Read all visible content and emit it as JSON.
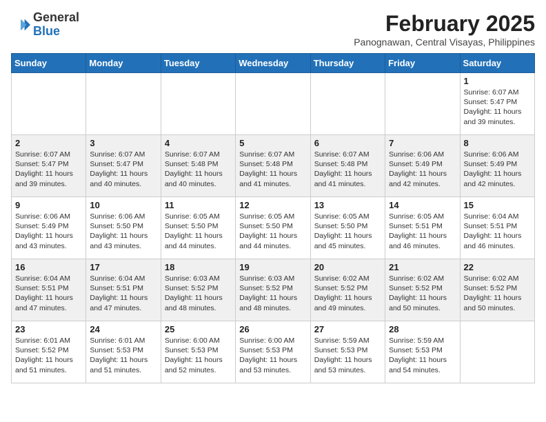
{
  "header": {
    "logo_general": "General",
    "logo_blue": "Blue",
    "month_year": "February 2025",
    "location": "Panognawan, Central Visayas, Philippines"
  },
  "days_of_week": [
    "Sunday",
    "Monday",
    "Tuesday",
    "Wednesday",
    "Thursday",
    "Friday",
    "Saturday"
  ],
  "weeks": [
    [
      {
        "day": "",
        "sunrise": "",
        "sunset": "",
        "daylight": ""
      },
      {
        "day": "",
        "sunrise": "",
        "sunset": "",
        "daylight": ""
      },
      {
        "day": "",
        "sunrise": "",
        "sunset": "",
        "daylight": ""
      },
      {
        "day": "",
        "sunrise": "",
        "sunset": "",
        "daylight": ""
      },
      {
        "day": "",
        "sunrise": "",
        "sunset": "",
        "daylight": ""
      },
      {
        "day": "",
        "sunrise": "",
        "sunset": "",
        "daylight": ""
      },
      {
        "day": "1",
        "sunrise": "Sunrise: 6:07 AM",
        "sunset": "Sunset: 5:47 PM",
        "daylight": "Daylight: 11 hours and 39 minutes."
      }
    ],
    [
      {
        "day": "2",
        "sunrise": "Sunrise: 6:07 AM",
        "sunset": "Sunset: 5:47 PM",
        "daylight": "Daylight: 11 hours and 39 minutes."
      },
      {
        "day": "3",
        "sunrise": "Sunrise: 6:07 AM",
        "sunset": "Sunset: 5:47 PM",
        "daylight": "Daylight: 11 hours and 40 minutes."
      },
      {
        "day": "4",
        "sunrise": "Sunrise: 6:07 AM",
        "sunset": "Sunset: 5:48 PM",
        "daylight": "Daylight: 11 hours and 40 minutes."
      },
      {
        "day": "5",
        "sunrise": "Sunrise: 6:07 AM",
        "sunset": "Sunset: 5:48 PM",
        "daylight": "Daylight: 11 hours and 41 minutes."
      },
      {
        "day": "6",
        "sunrise": "Sunrise: 6:07 AM",
        "sunset": "Sunset: 5:48 PM",
        "daylight": "Daylight: 11 hours and 41 minutes."
      },
      {
        "day": "7",
        "sunrise": "Sunrise: 6:06 AM",
        "sunset": "Sunset: 5:49 PM",
        "daylight": "Daylight: 11 hours and 42 minutes."
      },
      {
        "day": "8",
        "sunrise": "Sunrise: 6:06 AM",
        "sunset": "Sunset: 5:49 PM",
        "daylight": "Daylight: 11 hours and 42 minutes."
      }
    ],
    [
      {
        "day": "9",
        "sunrise": "Sunrise: 6:06 AM",
        "sunset": "Sunset: 5:49 PM",
        "daylight": "Daylight: 11 hours and 43 minutes."
      },
      {
        "day": "10",
        "sunrise": "Sunrise: 6:06 AM",
        "sunset": "Sunset: 5:50 PM",
        "daylight": "Daylight: 11 hours and 43 minutes."
      },
      {
        "day": "11",
        "sunrise": "Sunrise: 6:05 AM",
        "sunset": "Sunset: 5:50 PM",
        "daylight": "Daylight: 11 hours and 44 minutes."
      },
      {
        "day": "12",
        "sunrise": "Sunrise: 6:05 AM",
        "sunset": "Sunset: 5:50 PM",
        "daylight": "Daylight: 11 hours and 44 minutes."
      },
      {
        "day": "13",
        "sunrise": "Sunrise: 6:05 AM",
        "sunset": "Sunset: 5:50 PM",
        "daylight": "Daylight: 11 hours and 45 minutes."
      },
      {
        "day": "14",
        "sunrise": "Sunrise: 6:05 AM",
        "sunset": "Sunset: 5:51 PM",
        "daylight": "Daylight: 11 hours and 46 minutes."
      },
      {
        "day": "15",
        "sunrise": "Sunrise: 6:04 AM",
        "sunset": "Sunset: 5:51 PM",
        "daylight": "Daylight: 11 hours and 46 minutes."
      }
    ],
    [
      {
        "day": "16",
        "sunrise": "Sunrise: 6:04 AM",
        "sunset": "Sunset: 5:51 PM",
        "daylight": "Daylight: 11 hours and 47 minutes."
      },
      {
        "day": "17",
        "sunrise": "Sunrise: 6:04 AM",
        "sunset": "Sunset: 5:51 PM",
        "daylight": "Daylight: 11 hours and 47 minutes."
      },
      {
        "day": "18",
        "sunrise": "Sunrise: 6:03 AM",
        "sunset": "Sunset: 5:52 PM",
        "daylight": "Daylight: 11 hours and 48 minutes."
      },
      {
        "day": "19",
        "sunrise": "Sunrise: 6:03 AM",
        "sunset": "Sunset: 5:52 PM",
        "daylight": "Daylight: 11 hours and 48 minutes."
      },
      {
        "day": "20",
        "sunrise": "Sunrise: 6:02 AM",
        "sunset": "Sunset: 5:52 PM",
        "daylight": "Daylight: 11 hours and 49 minutes."
      },
      {
        "day": "21",
        "sunrise": "Sunrise: 6:02 AM",
        "sunset": "Sunset: 5:52 PM",
        "daylight": "Daylight: 11 hours and 50 minutes."
      },
      {
        "day": "22",
        "sunrise": "Sunrise: 6:02 AM",
        "sunset": "Sunset: 5:52 PM",
        "daylight": "Daylight: 11 hours and 50 minutes."
      }
    ],
    [
      {
        "day": "23",
        "sunrise": "Sunrise: 6:01 AM",
        "sunset": "Sunset: 5:52 PM",
        "daylight": "Daylight: 11 hours and 51 minutes."
      },
      {
        "day": "24",
        "sunrise": "Sunrise: 6:01 AM",
        "sunset": "Sunset: 5:53 PM",
        "daylight": "Daylight: 11 hours and 51 minutes."
      },
      {
        "day": "25",
        "sunrise": "Sunrise: 6:00 AM",
        "sunset": "Sunset: 5:53 PM",
        "daylight": "Daylight: 11 hours and 52 minutes."
      },
      {
        "day": "26",
        "sunrise": "Sunrise: 6:00 AM",
        "sunset": "Sunset: 5:53 PM",
        "daylight": "Daylight: 11 hours and 53 minutes."
      },
      {
        "day": "27",
        "sunrise": "Sunrise: 5:59 AM",
        "sunset": "Sunset: 5:53 PM",
        "daylight": "Daylight: 11 hours and 53 minutes."
      },
      {
        "day": "28",
        "sunrise": "Sunrise: 5:59 AM",
        "sunset": "Sunset: 5:53 PM",
        "daylight": "Daylight: 11 hours and 54 minutes."
      },
      {
        "day": "",
        "sunrise": "",
        "sunset": "",
        "daylight": ""
      }
    ]
  ]
}
